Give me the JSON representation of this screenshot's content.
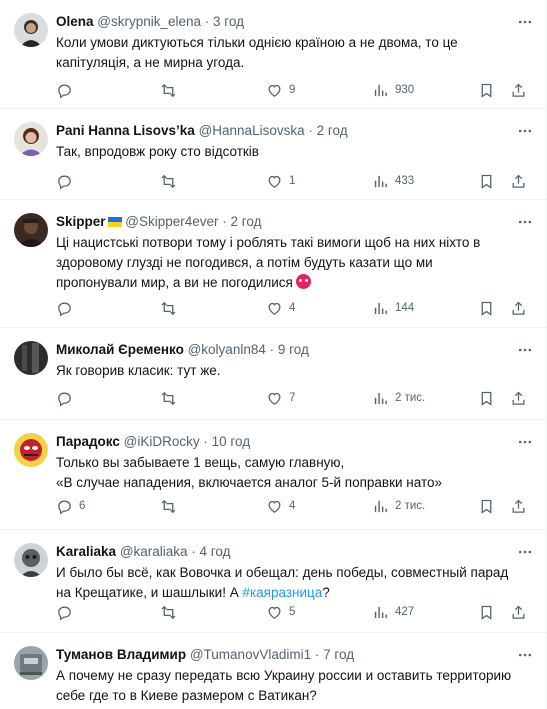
{
  "tweets": [
    {
      "name": "Olena",
      "handle": "@skrypnik_elena",
      "sep": " · ",
      "time": "3 год",
      "lines": [
        "Коли умови диктуються  тільки однією країною а не двома, то це",
        "капітуляція, а не мирна угода."
      ],
      "counts": {
        "reply": "",
        "retweet": "",
        "like": "9",
        "views": "930"
      }
    },
    {
      "name": "Pani Hanna Lisovs’ka",
      "handle": "@HannaLisovska",
      "sep": " · ",
      "time": "2 год",
      "lines": [
        "Так, впродовж року сто відсотків"
      ],
      "counts": {
        "reply": "",
        "retweet": "",
        "like": "1",
        "views": "433"
      }
    },
    {
      "name": "Skipper",
      "handle": "@Skipper4ever",
      "sep": " · ",
      "time": "2 год",
      "lines": [
        "Ці нацистські потвори тому і роблять такі вимоги щоб на них ніхто в",
        "здоровому глузді не погодився, а потім будуть казати що ми",
        "пропонували мир, а ви не погодилися"
      ],
      "counts": {
        "reply": "",
        "retweet": "",
        "like": "4",
        "views": "144"
      }
    },
    {
      "name": "Миколай Єременко",
      "handle": "@kolyanln84",
      "sep": " · ",
      "time": "9 год",
      "lines": [
        "Як говорив класик: тут же."
      ],
      "counts": {
        "reply": "",
        "retweet": "",
        "like": "7",
        "views": "2 тис."
      }
    },
    {
      "name": "Парадокс",
      "handle": "@iKiDRocky",
      "sep": " · ",
      "time": "10 год",
      "lines": [
        "Только вы забываете 1 вещь, самую главную,",
        "«В случае нападения, включается аналог 5-й поправки нато»"
      ],
      "counts": {
        "reply": "6",
        "retweet": "",
        "like": "4",
        "views": "2 тис."
      }
    },
    {
      "name": "Karaliaka",
      "handle": "@karaliaka",
      "sep": " · ",
      "time": "4 год",
      "lines": [
        "И было бы всё, как Вовочка и обещал: день победы,  совместный парад",
        "на Крещатике, и шашлыки! А "
      ],
      "hashtag": "#каяразница",
      "tail": "?",
      "counts": {
        "reply": "",
        "retweet": "",
        "like": "5",
        "views": "427"
      }
    },
    {
      "name": "Туманов Владимир",
      "handle": "@TumanovVladimi1",
      "sep": " · ",
      "time": "7 год",
      "lines": [
        "А почему не сразу передать всю Украину россии и оставить территорию",
        "себе где то в Киеве размером с Ватикан?"
      ],
      "counts": {}
    }
  ],
  "colors": {
    "text": "#0f1419",
    "secondary": "#536471",
    "link": "#1d9bf0",
    "divider": "#eff3f4"
  },
  "icons": [
    "reply-icon",
    "retweet-icon",
    "like-icon",
    "views-icon",
    "bookmark-icon",
    "share-icon",
    "more-icon"
  ]
}
